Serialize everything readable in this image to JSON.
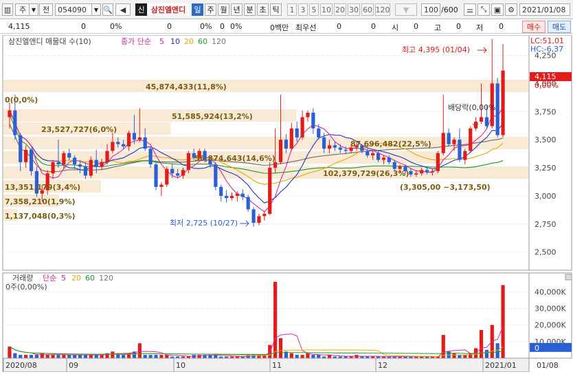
{
  "toolbar": {
    "period_type": "주",
    "prev_label": "전",
    "code": "054090",
    "stock_badge": "신",
    "stock_name": "삼진엘앤디",
    "tabs": [
      "일",
      "주",
      "월",
      "년",
      "분",
      "초",
      "틱"
    ],
    "active_tab": "일",
    "num_tabs": [
      "1",
      "3",
      "5",
      "10",
      "20",
      "30",
      "60",
      "120"
    ],
    "count": "100",
    "count_total": "/600",
    "date": "2021/01/08"
  },
  "quote": {
    "price": "4,115",
    "change": "0",
    "change_pct": "0%",
    "f1": "0",
    "f1_pct": "0%",
    "f2": "0",
    "f2_pct": "0%",
    "volume_unit": "0백만",
    "priority_label": "최우선",
    "bid": "0",
    "ask": "0",
    "open_label": "시",
    "open": "0",
    "high_label": "고",
    "high": "0",
    "low_label": "저",
    "low": "0",
    "buy_label": "매수",
    "sell_label": "매도"
  },
  "colors": {
    "up": "#e31b1b",
    "down": "#2a5fd6",
    "ma5": "#d42aa6",
    "ma10": "#2233cc",
    "ma20": "#f0a400",
    "ma60": "#1f9a2e",
    "ma120": "#6a6a6a",
    "band": "#f7e6cd",
    "label_olive": "#7a5d12"
  },
  "price_panel": {
    "legend": {
      "title": "삼진엘앤디 매물대 수(10)",
      "ma_title": "종가 단순",
      "m5": "5",
      "m10": "10",
      "m20": "20",
      "m60": "60",
      "m120": "120"
    },
    "lc": "LC:51,01",
    "hc": "HC:-6,37",
    "current_price": "4,115",
    "current_pct": "0,00%",
    "max_label": "최고 4,395 (01/04)",
    "min_label": "최저 2,725 (10/27)",
    "dividend_label": "배당락(0,00%",
    "price_range_label": "(3,305,00 ~3,173,50)",
    "zero_label": "0(0,0%)",
    "y_ticks": [
      "4,250",
      "4,000",
      "3,750",
      "3,500",
      "3,250",
      "3,000",
      "2,750",
      "2,500"
    ],
    "volume_profile": [
      {
        "label": "45,874,433(11,8%)"
      },
      {
        "label": "51,585,924(13,2%)"
      },
      {
        "label": "23,527,727(6,0%)"
      },
      {
        "label": "87,696,482(22,5%)"
      },
      {
        "label": "56,874,643(14,6%)"
      },
      {
        "label": "102,379,729(26,3%)"
      },
      {
        "label": "13,351,179(3,4%)"
      },
      {
        "label": "7,358,210(1,9%)"
      },
      {
        "label": "1,137,048(0,3%)"
      }
    ]
  },
  "volume_panel": {
    "legend": {
      "title": "거래량",
      "ma_title": "단순",
      "m5": "5",
      "m20": "20",
      "m60": "60",
      "m120": "120"
    },
    "zero_label": "0주(0,00%)",
    "current": "0",
    "y_ticks": [
      "40,000K",
      "30,000K",
      "20,000K",
      "10,000K"
    ]
  },
  "x_axis": [
    "2020/08",
    "09",
    "10",
    "11",
    "12",
    "2021/01"
  ],
  "x_axis_right": "01/08",
  "chart_data": {
    "type": "candlestick",
    "title": "삼진엘앤디",
    "ylim": [
      2400,
      4400
    ],
    "candles": [
      [
        3700,
        3830,
        3600,
        3760
      ],
      [
        3760,
        3900,
        3500,
        3540
      ],
      [
        3540,
        3560,
        3220,
        3300
      ],
      [
        3300,
        3450,
        3250,
        3410
      ],
      [
        3410,
        3420,
        3180,
        3220
      ],
      [
        3220,
        3260,
        2990,
        3020
      ],
      [
        3020,
        3100,
        2950,
        3050
      ],
      [
        3050,
        3230,
        3010,
        3200
      ],
      [
        3200,
        3320,
        3150,
        3300
      ],
      [
        3300,
        3500,
        3250,
        3280
      ],
      [
        3280,
        3400,
        3240,
        3380
      ],
      [
        3380,
        3420,
        3320,
        3340
      ],
      [
        3340,
        3360,
        3250,
        3280
      ],
      [
        3280,
        3320,
        3200,
        3260
      ],
      [
        3260,
        3300,
        3150,
        3180
      ],
      [
        3180,
        3350,
        3160,
        3320
      ],
      [
        3320,
        3410,
        3200,
        3260
      ],
      [
        3260,
        3330,
        3230,
        3300
      ],
      [
        3300,
        3460,
        3280,
        3400
      ],
      [
        3400,
        3560,
        3380,
        3480
      ],
      [
        3480,
        3520,
        3430,
        3460
      ],
      [
        3460,
        3500,
        3420,
        3440
      ],
      [
        3440,
        3580,
        3400,
        3560
      ],
      [
        3560,
        3720,
        3460,
        3500
      ],
      [
        3500,
        3780,
        3480,
        3520
      ],
      [
        3520,
        3600,
        3400,
        3420
      ],
      [
        3420,
        3440,
        3250,
        3280
      ],
      [
        3280,
        3300,
        3050,
        3080
      ],
      [
        3080,
        3120,
        3000,
        3100
      ],
      [
        3100,
        3260,
        3080,
        3240
      ],
      [
        3240,
        3280,
        3160,
        3200
      ],
      [
        3200,
        3240,
        3160,
        3180
      ],
      [
        3180,
        3250,
        3150,
        3230
      ],
      [
        3230,
        3400,
        3200,
        3380
      ],
      [
        3380,
        3420,
        3320,
        3340
      ],
      [
        3340,
        3420,
        3320,
        3400
      ],
      [
        3400,
        3420,
        3300,
        3320
      ],
      [
        3320,
        3340,
        3250,
        3280
      ],
      [
        3280,
        3300,
        3050,
        3080
      ],
      [
        3080,
        3100,
        2950,
        3000
      ],
      [
        3000,
        3050,
        2940,
        2980
      ],
      [
        2980,
        3030,
        2960,
        3000
      ],
      [
        3000,
        3040,
        2950,
        3020
      ],
      [
        3020,
        3060,
        2960,
        2990
      ],
      [
        2990,
        3010,
        2860,
        2880
      ],
      [
        2880,
        2900,
        2725,
        2760
      ],
      [
        2760,
        2840,
        2740,
        2820
      ],
      [
        2820,
        2860,
        2780,
        2840
      ],
      [
        2840,
        3300,
        2830,
        3250
      ],
      [
        3250,
        3600,
        3200,
        3300
      ],
      [
        3300,
        3900,
        3280,
        3500
      ],
      [
        3500,
        3550,
        3380,
        3420
      ],
      [
        3420,
        3650,
        3400,
        3600
      ],
      [
        3600,
        3660,
        3480,
        3520
      ],
      [
        3520,
        3760,
        3500,
        3700
      ],
      [
        3700,
        3760,
        3660,
        3740
      ],
      [
        3740,
        3780,
        3550,
        3600
      ],
      [
        3600,
        3640,
        3500,
        3520
      ],
      [
        3520,
        3560,
        3380,
        3420
      ],
      [
        3420,
        3500,
        3380,
        3450
      ],
      [
        3450,
        3480,
        3400,
        3430
      ],
      [
        3430,
        3460,
        3380,
        3410
      ],
      [
        3410,
        3440,
        3370,
        3400
      ],
      [
        3400,
        3460,
        3380,
        3430
      ],
      [
        3430,
        3480,
        3400,
        3450
      ],
      [
        3450,
        3460,
        3380,
        3400
      ],
      [
        3400,
        3420,
        3340,
        3360
      ],
      [
        3360,
        3400,
        3320,
        3380
      ],
      [
        3380,
        3400,
        3300,
        3320
      ],
      [
        3320,
        3360,
        3280,
        3340
      ],
      [
        3340,
        3360,
        3280,
        3300
      ],
      [
        3300,
        3320,
        3220,
        3240
      ],
      [
        3240,
        3280,
        3200,
        3260
      ],
      [
        3260,
        3280,
        3200,
        3220
      ],
      [
        3220,
        3250,
        3170,
        3190
      ],
      [
        3190,
        3230,
        3170,
        3200
      ],
      [
        3200,
        3250,
        3180,
        3230
      ],
      [
        3230,
        3250,
        3190,
        3210
      ],
      [
        3210,
        3240,
        3180,
        3220
      ],
      [
        3220,
        3400,
        3200,
        3380
      ],
      [
        3380,
        3900,
        3360,
        3560
      ],
      [
        3560,
        3600,
        3440,
        3460
      ],
      [
        3460,
        3520,
        3400,
        3500
      ],
      [
        3500,
        3600,
        3300,
        3320
      ],
      [
        3320,
        3420,
        3280,
        3400
      ],
      [
        3400,
        3620,
        3380,
        3600
      ],
      [
        3600,
        3700,
        3580,
        3660
      ],
      [
        3660,
        4000,
        3640,
        3700
      ],
      [
        3700,
        3800,
        3600,
        3620
      ],
      [
        3620,
        4395,
        3600,
        4000
      ],
      [
        4000,
        4050,
        3520,
        3540
      ],
      [
        3540,
        4350,
        3520,
        4115
      ]
    ],
    "volume": [
      7,
      3,
      2,
      2,
      2,
      2,
      3,
      2,
      2,
      2,
      2,
      2,
      2,
      2,
      2,
      2,
      2,
      2,
      3,
      4,
      3,
      2,
      3,
      4,
      9,
      2,
      2,
      2,
      2,
      2,
      1,
      1,
      1,
      1,
      2,
      2,
      2,
      2,
      2,
      1,
      1,
      1,
      1,
      1,
      2,
      2,
      2,
      2,
      8,
      46,
      12,
      4,
      3,
      2,
      2,
      3,
      2,
      2,
      1,
      2,
      1,
      1,
      1,
      1,
      2,
      1,
      1,
      1,
      1,
      1,
      1,
      1,
      1,
      1,
      1,
      1,
      1,
      1,
      1,
      1,
      14,
      4,
      3,
      2,
      2,
      3,
      6,
      17,
      5,
      20,
      9,
      44
    ]
  }
}
